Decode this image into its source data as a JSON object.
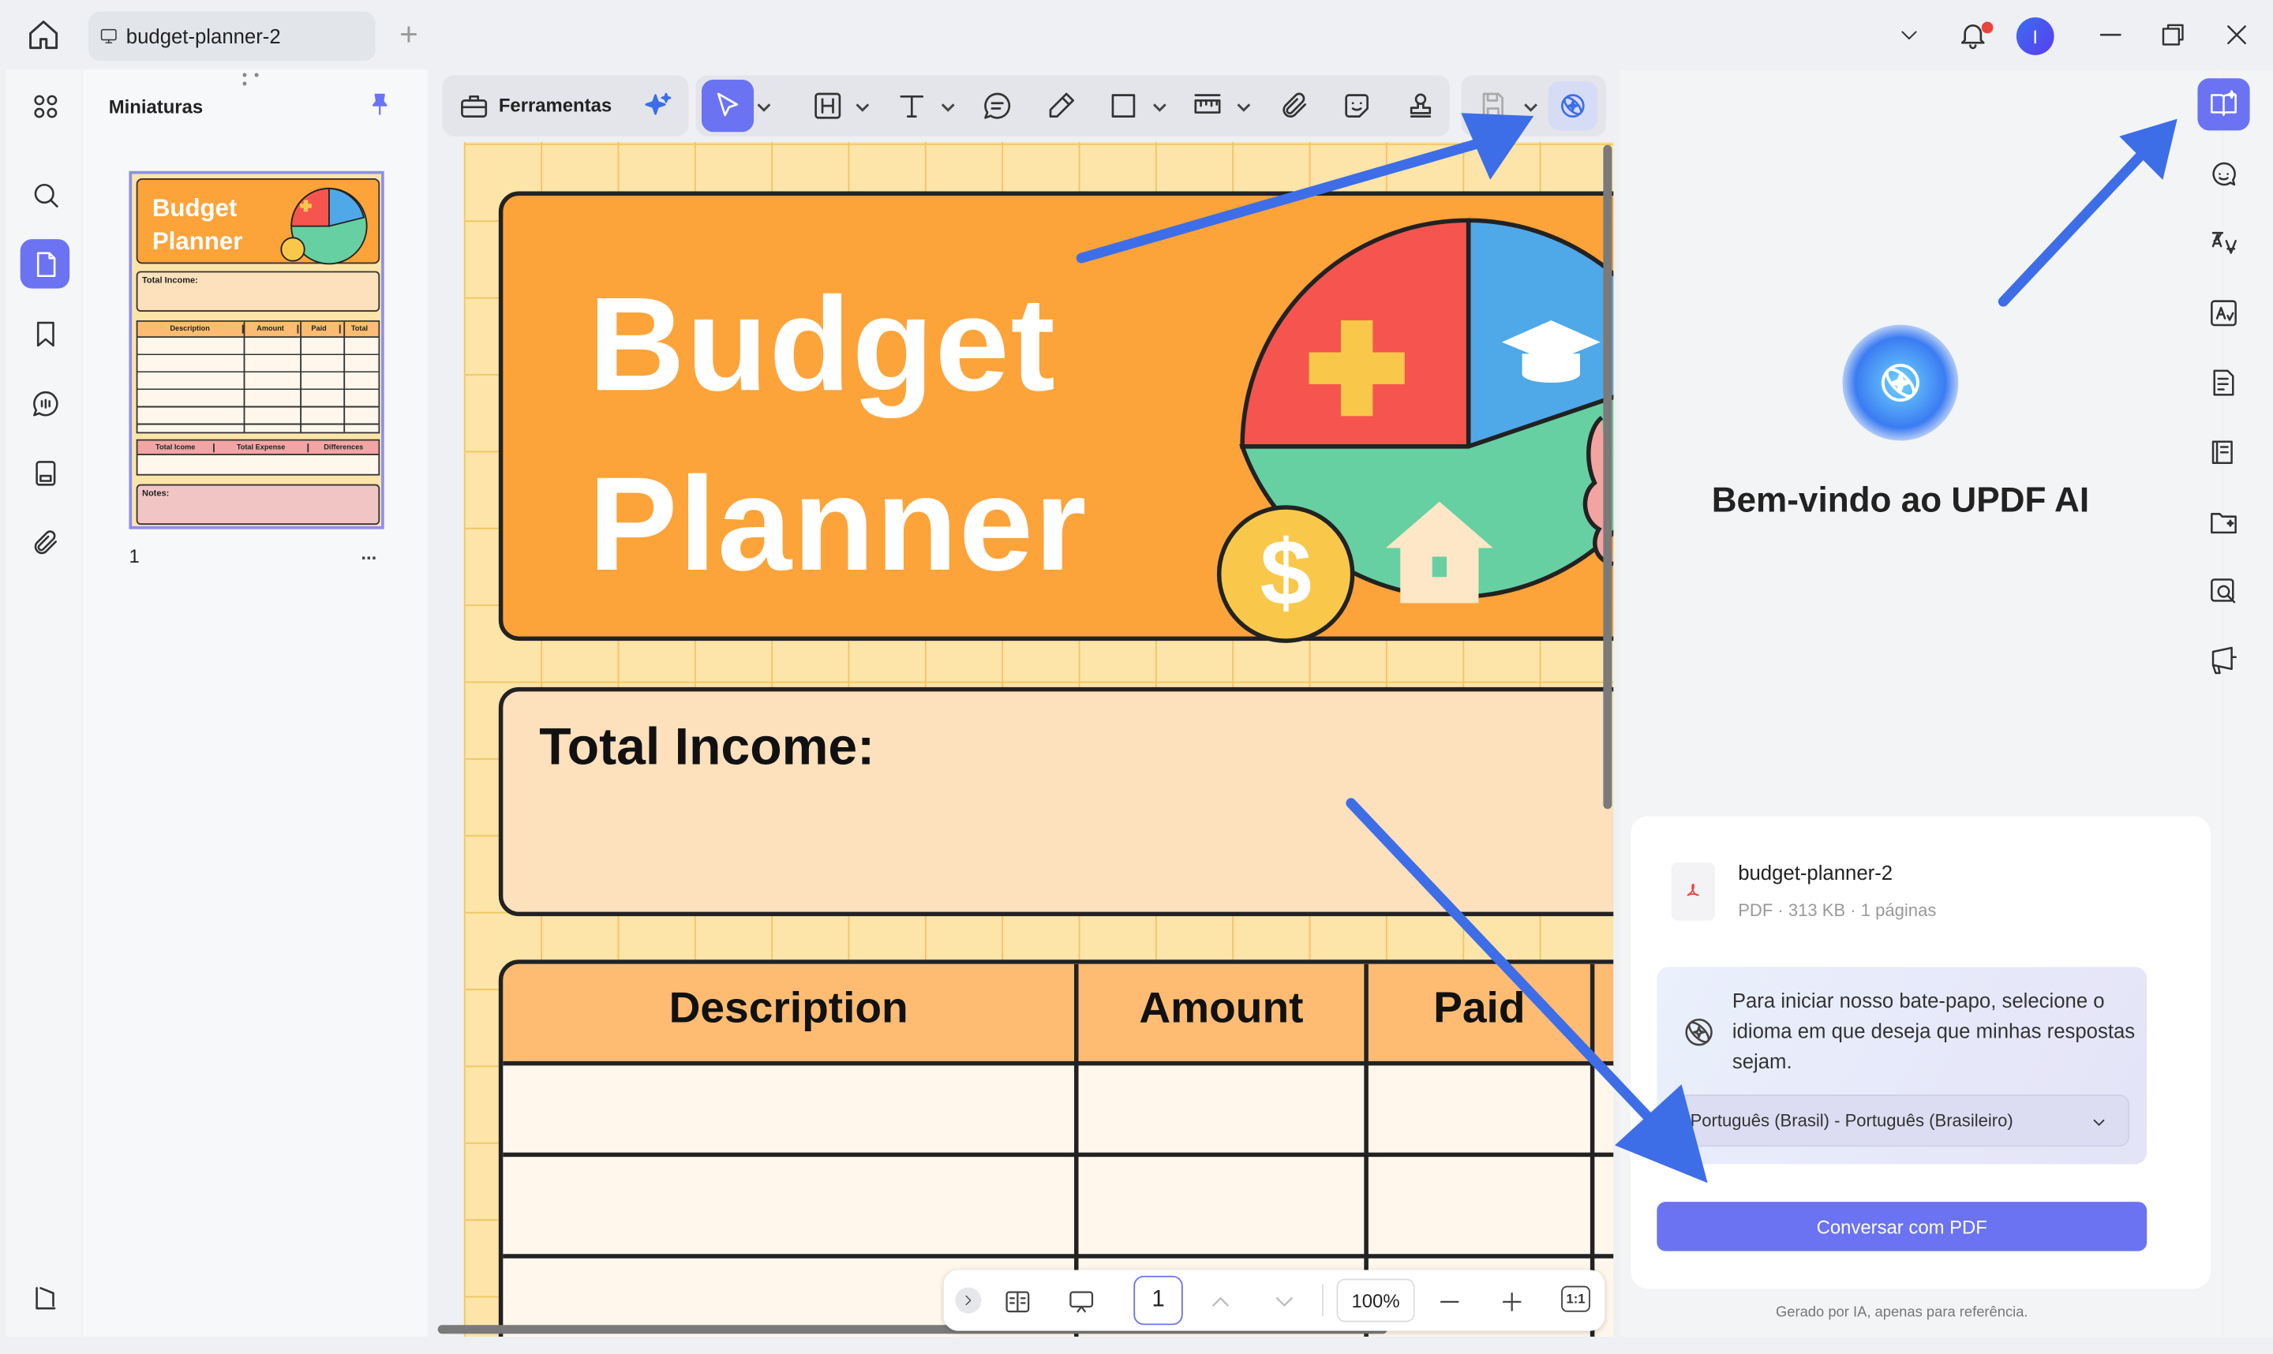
{
  "tab": {
    "title": "budget-planner-2",
    "new_tab": "+"
  },
  "window": {
    "user_initial": "I"
  },
  "thumbnails": {
    "title": "Miniaturas",
    "page_number": "1",
    "more": "...",
    "mini": {
      "title_l1": "Budget",
      "title_l2": "Planner",
      "income": "Total Income:",
      "headers": [
        "Description",
        "Amount",
        "Paid",
        "Total"
      ],
      "totals": [
        "Total Icome",
        "Total Expense",
        "Differences"
      ],
      "notes": "Notes:"
    }
  },
  "toolbar": {
    "tools_label": "Ferramentas"
  },
  "document": {
    "title_line1": "Budget",
    "title_line2": "Planner",
    "dollar": "$",
    "income_label": "Total Income:",
    "table_headers": [
      "Description",
      "Amount",
      "Paid"
    ]
  },
  "bottom": {
    "page": "1",
    "zoom": "100%",
    "fit": "1:1"
  },
  "ai": {
    "welcome": "Bem-vindo ao UPDF AI",
    "file_name": "budget-planner-2",
    "file_meta": "PDF · 313 KB · 1 páginas",
    "prompt": "Para iniciar nosso bate-papo, selecione o idioma em que deseja que minhas respostas sejam.",
    "language": "Português (Brasil) - Português (Brasileiro)",
    "chat_button": "Conversar com PDF",
    "footer": "Gerado por IA, apenas para referência."
  },
  "colors": {
    "accent": "#6b73f2",
    "orange": "#fca33a",
    "arrow": "#3d6ee8"
  }
}
